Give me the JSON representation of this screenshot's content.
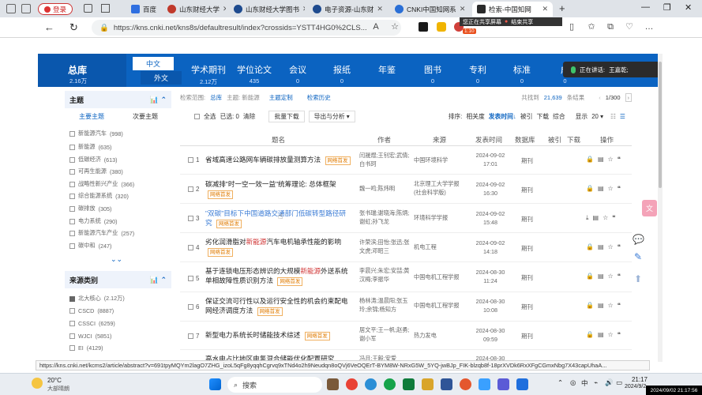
{
  "browser": {
    "login_label": "登录",
    "tabs": [
      {
        "label": "百度",
        "active": false
      },
      {
        "label": "山东财经大学",
        "active": false
      },
      {
        "label": "山东财经大学图书",
        "active": false
      },
      {
        "label": "电子资源-山东财",
        "active": false
      },
      {
        "label": "CNKI中国知网系",
        "active": false
      },
      {
        "label": "检索-中国知网",
        "active": true
      }
    ],
    "new_tab": "+",
    "url": "https://kns.cnki.net/kns8s/defaultresult/index?crossids=YSTT4HG0%2CLS...",
    "share_bar": {
      "status": "您正在共享屏幕",
      "stop": "结束共享",
      "timer": "1:10"
    }
  },
  "cnki": {
    "zongku": {
      "label": "总库",
      "count": "2.16万"
    },
    "lang": {
      "zh": "中文",
      "en": "外文"
    },
    "db_tabs": [
      {
        "label": "学术期刊",
        "count": "2.12万"
      },
      {
        "label": "学位论文",
        "count": "435"
      },
      {
        "label": "会议",
        "count": "0"
      },
      {
        "label": "报纸",
        "count": "0"
      },
      {
        "label": "年鉴",
        "count": ""
      },
      {
        "label": "图书",
        "count": "0"
      },
      {
        "label": "专利",
        "count": "0"
      },
      {
        "label": "标准",
        "count": "0"
      },
      {
        "label": "成",
        "count": "0"
      }
    ],
    "speaking": "正在讲话:",
    "speaker": "王嘉乾;"
  },
  "sidebar": {
    "topic": {
      "title": "主题",
      "tabs": [
        "主要主题",
        "次要主题"
      ],
      "items": [
        {
          "label": "新能源汽车",
          "count": "(998)"
        },
        {
          "label": "新能源",
          "count": "(635)"
        },
        {
          "label": "低碳经济",
          "count": "(613)"
        },
        {
          "label": "可再生能源",
          "count": "(380)"
        },
        {
          "label": "战略性新兴产业",
          "count": "(366)"
        },
        {
          "label": "综合能源系统",
          "count": "(320)"
        },
        {
          "label": "碳排放",
          "count": "(305)"
        },
        {
          "label": "电力系统",
          "count": "(290)"
        },
        {
          "label": "新能源汽车产业",
          "count": "(257)"
        },
        {
          "label": "碳中和",
          "count": "(247)"
        }
      ]
    },
    "source": {
      "title": "来源类别",
      "items": [
        {
          "label": "北大核心",
          "count": "(2.12万)",
          "checked": true
        },
        {
          "label": "CSCD",
          "count": "(8887)",
          "checked": false
        },
        {
          "label": "CSSCI",
          "count": "(6259)",
          "checked": false
        },
        {
          "label": "WJCI",
          "count": "(5851)",
          "checked": false
        },
        {
          "label": "EI",
          "count": "(4129)",
          "checked": false
        }
      ]
    }
  },
  "results": {
    "scope_label": "检索范围:",
    "scope_value": "总库",
    "topic_label": "主题: 新能源",
    "topic_custom": "主题定制",
    "history": "检索历史",
    "total_prefix": "共找到",
    "total": "21,639",
    "total_suffix": "条结果",
    "page": "1/300",
    "select_all": "全选",
    "selected": "已选: 0",
    "clear": "清除",
    "batch_download": "批量下载",
    "export": "导出与分析",
    "sort_label": "排序:",
    "sort_options": [
      "相关度",
      "发表时间",
      "被引",
      "下载",
      "综合"
    ],
    "display_label": "显示",
    "page_size": "20",
    "columns": [
      "题名",
      "作者",
      "来源",
      "发表时间",
      "数据库",
      "被引",
      "下载",
      "操作"
    ],
    "tag_label": "网络首发",
    "rows": [
      {
        "no": "1",
        "title": "省域高速公路网车辆碳排放量测算方法",
        "hl": "",
        "author": "闫晟煜;王钊宏;武倩;白书珂",
        "source": "中国环境科学",
        "date": "2024-09-02 17:01",
        "db": "期刊",
        "tag": true
      },
      {
        "no": "2",
        "title": "碳减排\"时一空一效一益\"统筹理论: 总体框架",
        "hl": "",
        "author": "魏一鸣;陈炜明",
        "source": "北京理工大学学报(社会科学版)",
        "date": "2024-09-02 16:30",
        "db": "期刊",
        "tag": true
      },
      {
        "no": "3",
        "title": "\"双碳\"目标下中国道路交通部门低碳转型路径研究",
        "hl": "",
        "author": "张书瑞;谢晓海;陈炳;谢虹;孙飞龙",
        "source": "环境科学学报",
        "date": "2024-09-02 15:48",
        "db": "期刊",
        "tag": true
      },
      {
        "no": "4",
        "title": "劣化润滑脂对新能源汽车电机轴承性能的影响",
        "hl": "新能源",
        "author": "许荣滨;田怡;张迅;张文虎;邓昭三",
        "source": "机电工程",
        "date": "2024-09-02 14:18",
        "db": "期刊",
        "tag": true
      },
      {
        "no": "5",
        "title": "基于连锁电压形态辨识的大规模新能源外送系统单相故障性质识别方法",
        "hl": "新能源",
        "author": "李晨兴;朱宏;安喆;黄汉梅;李振华",
        "source": "中国电机工程学报",
        "date": "2024-08-30 11:24",
        "db": "期刊",
        "tag": true
      },
      {
        "no": "6",
        "title": "保证交流可行性以及运行安全性的机会约束配电网经济调度方法",
        "hl": "",
        "author": "杨林涛;温晨阳;张玉玲;余锦;杨知方",
        "source": "中国电机工程学报",
        "date": "2024-08-30 10:08",
        "db": "期刊",
        "tag": true
      },
      {
        "no": "7",
        "title": "新型电力系统长时储能技术综述",
        "hl": "",
        "author": "居文平;王一帆;赵勇;谢小军",
        "source": "热力发电",
        "date": "2024-08-30 09:59",
        "db": "期刊",
        "tag": true
      },
      {
        "no": "8",
        "title": "高水电占比地区电氢混合储能优化配置研究",
        "hl": "",
        "author": "冯月;王毅;安爱",
        "source": "中国电机工程学报",
        "date": "2024-08-30",
        "db": "期刊",
        "tag": false
      }
    ]
  },
  "status_url": "https://kns.cnki.net/kcms2/article/abstract?v=691tpyMQYm2lagO7ZHG_izoL5qFg8yqqhCgrvq9xTNd4o2h9Neudqn8oQVj6VeOQErT-BYM8W-NRxG5W_5YQ-jwBJp_FIK-blzqb8f-18prXVDk6RxXFgCGmxNbg7X43capUhaA...",
  "taskbar": {
    "weather_temp": "20°C",
    "weather_desc": "大部晴朗",
    "search_label": "搜索",
    "ime": "中",
    "time": "21:17",
    "date": "2024/9/2",
    "recording": "2024/09/02 21:17:56"
  }
}
